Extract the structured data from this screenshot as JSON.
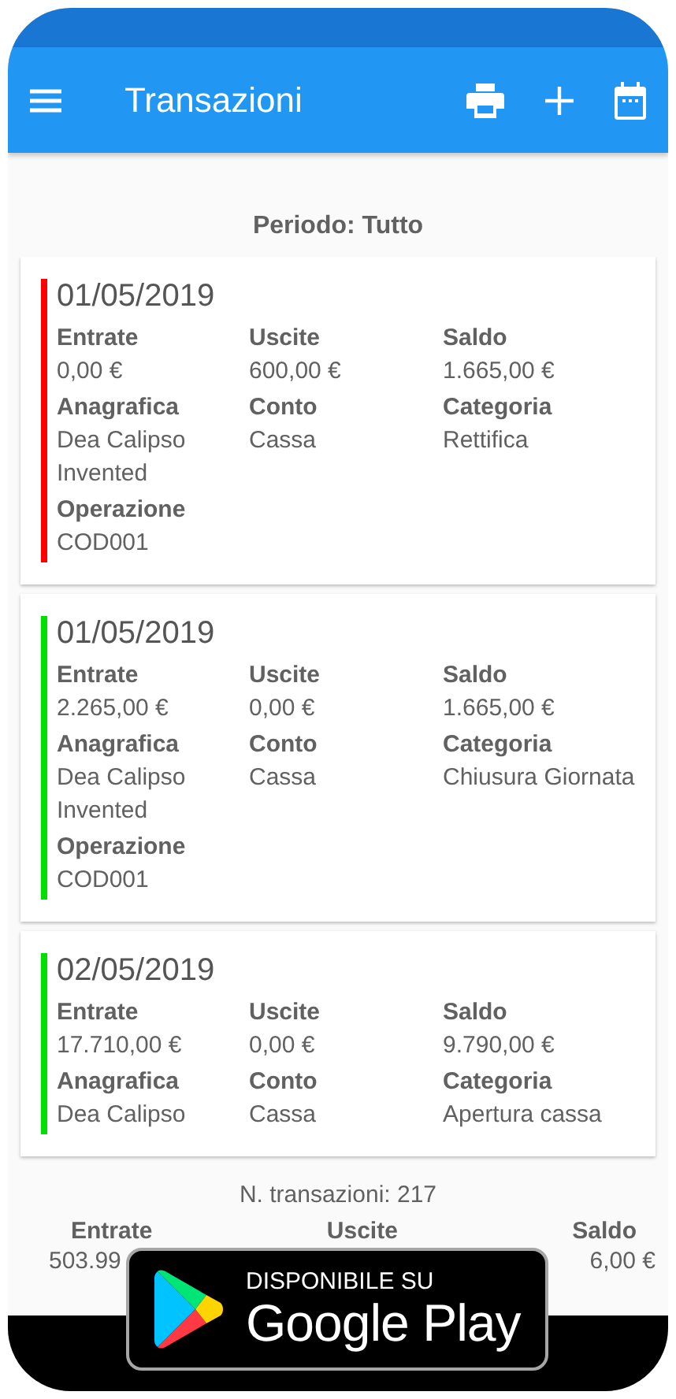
{
  "app_bar": {
    "title": "Transazioni"
  },
  "period": "Periodo: Tutto",
  "transactions": [
    {
      "date": "01/05/2019",
      "color": "#ff0000",
      "fields": [
        {
          "label": "Entrate",
          "value": "0,00 €"
        },
        {
          "label": "Uscite",
          "value": "600,00 €"
        },
        {
          "label": "Saldo",
          "value": "1.665,00 €"
        },
        {
          "label": "Anagrafica",
          "value": "Dea Calipso Invented"
        },
        {
          "label": "Conto",
          "value": "Cassa"
        },
        {
          "label": "Categoria",
          "value": "Rettifica"
        },
        {
          "label": "Operazione",
          "value": "COD001"
        }
      ]
    },
    {
      "date": "01/05/2019",
      "color": "#00e000",
      "fields": [
        {
          "label": "Entrate",
          "value": "2.265,00 €"
        },
        {
          "label": "Uscite",
          "value": "0,00 €"
        },
        {
          "label": "Saldo",
          "value": "1.665,00 €"
        },
        {
          "label": "Anagrafica",
          "value": "Dea Calipso Invented"
        },
        {
          "label": "Conto",
          "value": "Cassa"
        },
        {
          "label": "Categoria",
          "value": "Chiusura Giornata"
        },
        {
          "label": "Operazione",
          "value": "COD001"
        }
      ]
    },
    {
      "date": "02/05/2019",
      "color": "#00e000",
      "fields": [
        {
          "label": "Entrate",
          "value": "17.710,00 €"
        },
        {
          "label": "Uscite",
          "value": "0,00 €"
        },
        {
          "label": "Saldo",
          "value": "9.790,00 €"
        },
        {
          "label": "Anagrafica",
          "value": "Dea Calipso"
        },
        {
          "label": "Conto",
          "value": "Cassa"
        },
        {
          "label": "Categoria",
          "value": "Apertura cassa"
        }
      ]
    }
  ],
  "summary": {
    "count": "N. transazioni: 217",
    "labels": [
      "Entrate",
      "Uscite",
      "Saldo"
    ],
    "values_visible": [
      "503.99",
      "6,00 €"
    ]
  },
  "store_badge": {
    "caption": "DISPONIBILE SU",
    "store": "Google Play"
  }
}
